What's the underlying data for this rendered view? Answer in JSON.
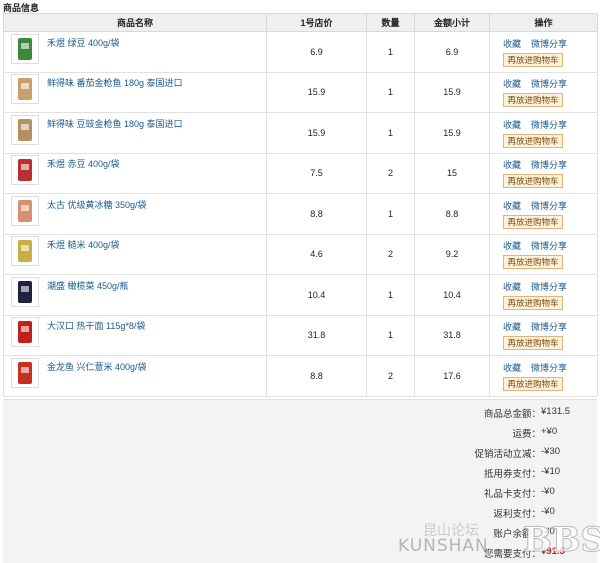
{
  "section_title": "商品信息",
  "columns": [
    "商品名称",
    "1号店价",
    "数量",
    "金额小计",
    "操作"
  ],
  "actions": {
    "favorite": "收藏",
    "share": "微博分享",
    "rebuy": "再放进购物车"
  },
  "items": [
    {
      "name": "禾煜 绿豆 400g/袋",
      "price": "6.9",
      "qty": "1",
      "subtotal": "6.9",
      "icon": "green-bean-bag-icon",
      "thumb_color": "#3a8a3a"
    },
    {
      "name": "鲜得味 番茄金枪鱼 180g 泰国进口",
      "price": "15.9",
      "qty": "1",
      "subtotal": "15.9",
      "icon": "tuna-can-icon",
      "thumb_color": "#c8a070"
    },
    {
      "name": "鲜得味 豆豉金枪鱼 180g 泰国进口",
      "price": "15.9",
      "qty": "1",
      "subtotal": "15.9",
      "icon": "tuna-can-icon",
      "thumb_color": "#b89060"
    },
    {
      "name": "禾煜 赤豆 400g/袋",
      "price": "7.5",
      "qty": "2",
      "subtotal": "15",
      "icon": "red-bean-bag-icon",
      "thumb_color": "#b83030"
    },
    {
      "name": "太古 优级黄冰糖 350g/袋",
      "price": "8.8",
      "qty": "1",
      "subtotal": "8.8",
      "icon": "rock-sugar-bag-icon",
      "thumb_color": "#d89070"
    },
    {
      "name": "禾煜 糙米 400g/袋",
      "price": "4.6",
      "qty": "2",
      "subtotal": "9.2",
      "icon": "brown-rice-bag-icon",
      "thumb_color": "#c8b040"
    },
    {
      "name": "潮盛 橄榄菜 450g/瓶",
      "price": "10.4",
      "qty": "1",
      "subtotal": "10.4",
      "icon": "olive-vegetable-jar-icon",
      "thumb_color": "#202040"
    },
    {
      "name": "大汉口 热干面 115g*8/袋",
      "price": "31.8",
      "qty": "1",
      "subtotal": "31.8",
      "icon": "noodle-bag-icon",
      "thumb_color": "#c02020"
    },
    {
      "name": "金龙鱼 兴仁薏米 400g/袋",
      "price": "8.8",
      "qty": "2",
      "subtotal": "17.6",
      "icon": "coix-seed-bag-icon",
      "thumb_color": "#c83020"
    }
  ],
  "summary": [
    {
      "label": "商品总金额：",
      "value": "¥131.5"
    },
    {
      "label": "运费：",
      "value": "+¥0"
    },
    {
      "label": "促销活动立减：",
      "value": "-¥30"
    },
    {
      "label": "抵用券支付：",
      "value": "-¥10"
    },
    {
      "label": "礼品卡支付：",
      "value": "-¥0"
    },
    {
      "label": "返利支付：",
      "value": "-¥0"
    },
    {
      "label": "账户余额：",
      "value": "-¥0"
    },
    {
      "label": "您需要支付：",
      "value": "¥91.5",
      "highlight": true
    }
  ],
  "watermark": {
    "cn": "昆山论坛",
    "en": "KUNSHAN",
    "bbs": "BBS"
  }
}
